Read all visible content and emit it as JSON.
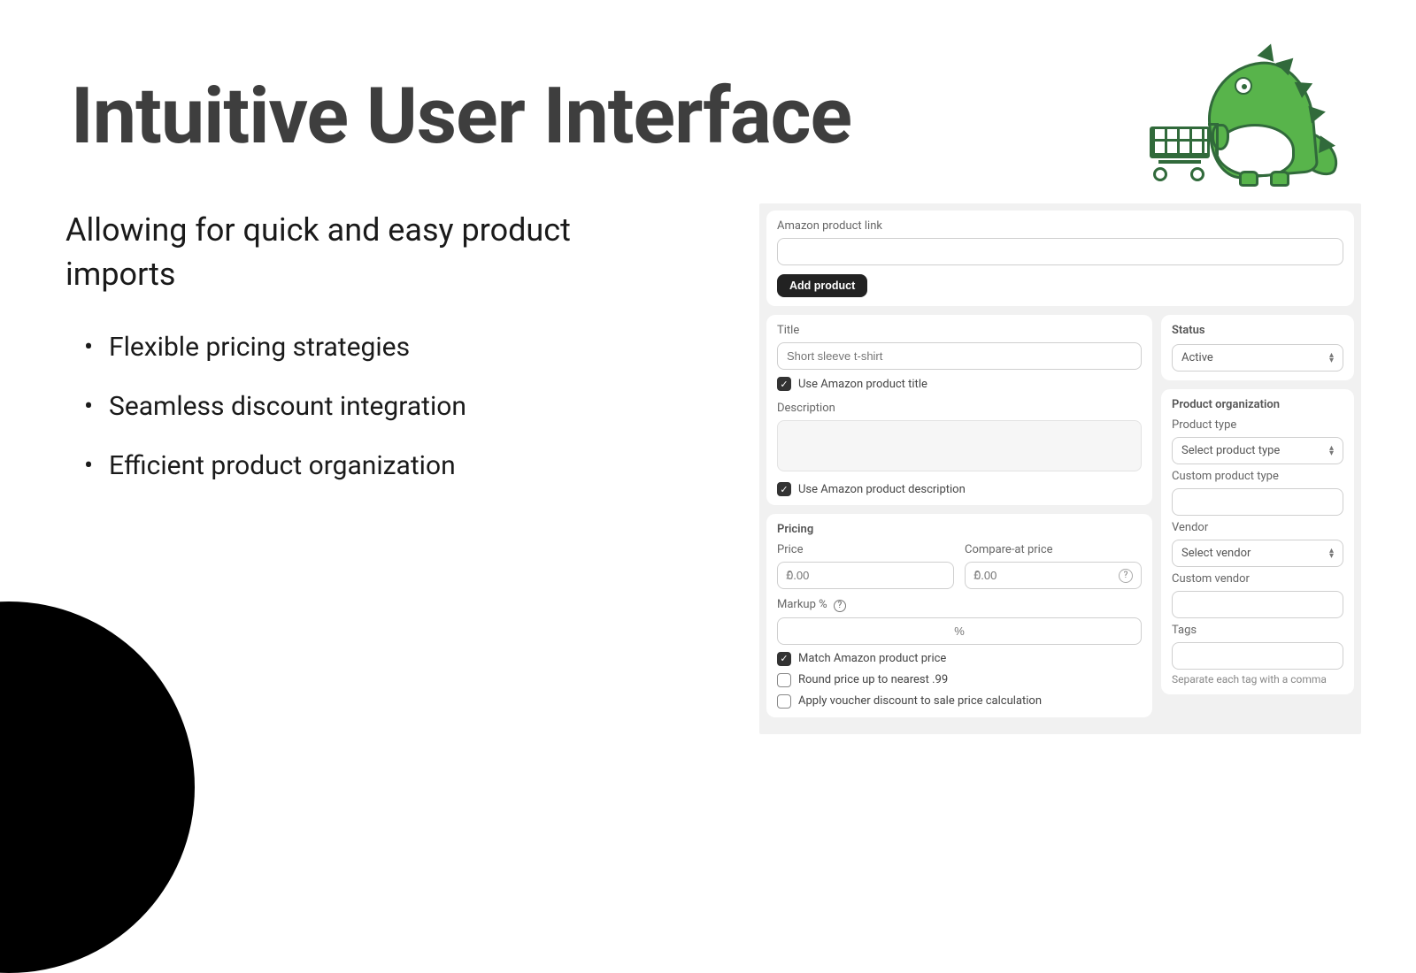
{
  "slide": {
    "title": "Intuitive User Interface",
    "subtitle": "Allowing for quick and easy product imports",
    "bullets": [
      "Flexible pricing strategies",
      "Seamless discount integration",
      "Efficient product organization"
    ]
  },
  "form": {
    "link_section": {
      "label": "Amazon product link",
      "value": "",
      "add_button": "Add product"
    },
    "title_section": {
      "label": "Title",
      "placeholder": "Short sleeve t-shirt",
      "use_amazon_title": {
        "label": "Use Amazon product title",
        "checked": true
      },
      "description_label": "Description",
      "use_amazon_description": {
        "label": "Use Amazon product description",
        "checked": true
      }
    },
    "pricing": {
      "heading": "Pricing",
      "price_label": "Price",
      "price_currency": "£",
      "price_placeholder": "0.00",
      "compare_label": "Compare-at price",
      "compare_currency": "£",
      "compare_placeholder": "0.00",
      "markup_label": "Markup %",
      "markup_unit": "%",
      "match_price": {
        "label": "Match Amazon product price",
        "checked": true
      },
      "round_up": {
        "label": "Round price up to nearest .99",
        "checked": false
      },
      "voucher": {
        "label": "Apply voucher discount to sale price calculation",
        "checked": false
      }
    },
    "status": {
      "heading": "Status",
      "value": "Active"
    },
    "organization": {
      "heading": "Product organization",
      "product_type_label": "Product type",
      "product_type_value": "Select product type",
      "custom_type_label": "Custom product type",
      "vendor_label": "Vendor",
      "vendor_value": "Select vendor",
      "custom_vendor_label": "Custom vendor",
      "tags_label": "Tags",
      "tags_hint": "Separate each tag with a comma"
    }
  }
}
